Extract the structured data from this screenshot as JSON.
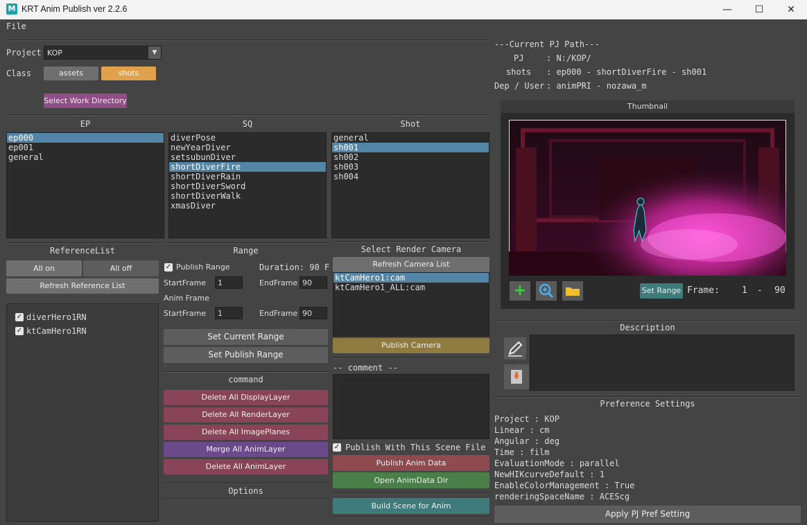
{
  "window": {
    "title": "KRT Anim Publish   ver 2.2.6",
    "app_icon": "M"
  },
  "menu": {
    "file": "File"
  },
  "project": {
    "label": "Project",
    "value": "KOP"
  },
  "class": {
    "label": "Class",
    "assets": "assets",
    "shots": "shots"
  },
  "select_work_dir": "Select Work Directory",
  "pj_path": {
    "header": "---Current PJ Path---",
    "pj_label": "PJ",
    "pj_value": ": N:/KOP/",
    "shots_label": "shots",
    "shots_value": ": ep000 - shortDiverFire - sh001",
    "dep_label": "Dep / User",
    "dep_value": ": animPRI - nozawa_m"
  },
  "ep": {
    "header": "EP",
    "items": [
      "ep000",
      "ep001",
      "general"
    ],
    "selected": 0
  },
  "sq": {
    "header": "SQ",
    "items": [
      "diverPose",
      "newYearDiver",
      "setsubunDiver",
      "shortDiverFire",
      "shortDiverRain",
      "shortDiverSword",
      "shortDiverWalk",
      "xmasDiver"
    ],
    "selected": 3
  },
  "shot": {
    "header": "Shot",
    "items": [
      "general",
      "sh001",
      "sh002",
      "sh003",
      "sh004"
    ],
    "selected": 1
  },
  "thumbnail": {
    "header": "Thumbnail",
    "set_range": "Set Range",
    "frame_label": "Frame:",
    "frame_start": "1",
    "frame_dash": "-",
    "frame_end": "90"
  },
  "reference": {
    "header": "ReferenceList",
    "all_on": "All on",
    "all_off": "All off",
    "refresh": "Refresh Reference List",
    "items": [
      "diverHero1RN",
      "ktCamHero1RN"
    ]
  },
  "range": {
    "header": "Range",
    "publish_range": "Publish Range",
    "duration": "Duration: 90 F",
    "start_label": "StartFrame",
    "start_value": "1",
    "end_label": "EndFrame",
    "end_value": "90",
    "anim_frame": "Anim Frame",
    "anim_start_label": "StartFrame",
    "anim_start_value": "1",
    "anim_end_label": "EndFrame",
    "anim_end_value": "90",
    "set_current": "Set Current Range",
    "set_publish": "Set Publish Range"
  },
  "command": {
    "header": "command",
    "delete_display": "Delete All DisplayLayer",
    "delete_render": "Delete All RenderLayer",
    "delete_image": "Delete All ImagePlanes",
    "merge_anim": "Merge All AnimLayer",
    "delete_anim": "Delete All AnimLayer"
  },
  "options": {
    "header": "Options"
  },
  "camera": {
    "header": "Select Render Camera",
    "refresh": "Refresh Camera List",
    "items": [
      "ktCamHero1:cam",
      "ktCamHero1_ALL:cam"
    ],
    "selected": 0,
    "publish": "Publish Camera"
  },
  "comment": {
    "header": "-- comment --"
  },
  "publish": {
    "with_scene": "Publish With This Scene File",
    "publish_anim": "Publish Anim Data",
    "open_dir": "Open AnimData Dir",
    "build_scene": "Build Scene for Anim"
  },
  "description": {
    "header": "Description"
  },
  "preferences": {
    "header": "Preference Settings",
    "lines": [
      "Project : KOP",
      "Linear : cm",
      "Angular : deg",
      "Time : film",
      "EvaluationMode : parallel",
      "NewHIKcurveDefault : 1",
      "EnableColorManagement : True",
      "renderingSpaceName : ACEScg"
    ],
    "apply": "Apply PJ Pref Setting"
  },
  "icons": {
    "add": "plus-icon",
    "zoom": "zoom-in-icon",
    "folder": "folder-icon",
    "pencil": "pencil-icon",
    "download": "download-icon"
  },
  "colors": {
    "bg": "#444444",
    "selection": "#5285a6",
    "shots_orange": "#e1a04c",
    "work_dir_purple": "#8f4f86",
    "command_red": "#8a4459",
    "merge_purple": "#6b4a8c",
    "camera_gold": "#8f7a3f",
    "publish_red": "#8f4a4f",
    "open_green": "#4a7f4a",
    "build_teal": "#3f7b7b"
  }
}
